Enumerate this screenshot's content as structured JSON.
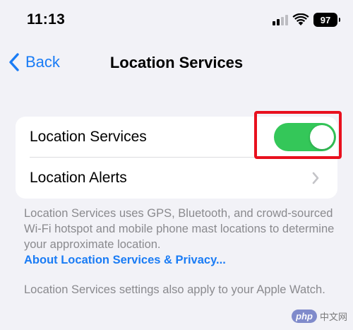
{
  "status_bar": {
    "time": "11:13",
    "battery_level": "97"
  },
  "nav": {
    "back_label": "Back",
    "title": "Location Services"
  },
  "settings": {
    "rows": [
      {
        "label": "Location Services",
        "control": "toggle",
        "toggle_on": true
      },
      {
        "label": "Location Alerts",
        "control": "chevron"
      }
    ],
    "footer": "Location Services uses GPS, Bluetooth, and crowd-sourced Wi-Fi hotspot and mobile phone mast locations to determine your approximate location.",
    "privacy_link": "About Location Services & Privacy...",
    "footer_2": "Location Services settings also apply to your Apple Watch."
  },
  "watermark": {
    "brand": "php",
    "text": "中文网"
  },
  "colors": {
    "accent": "#1a7cf5",
    "toggle_on": "#34c759",
    "highlight": "#e8101e",
    "background": "#f2f2f7",
    "footer_text": "#8a8a8e"
  },
  "icons": [
    "signal-icon",
    "wifi-icon",
    "battery-icon",
    "back-chevron-icon",
    "chevron-right-icon"
  ]
}
